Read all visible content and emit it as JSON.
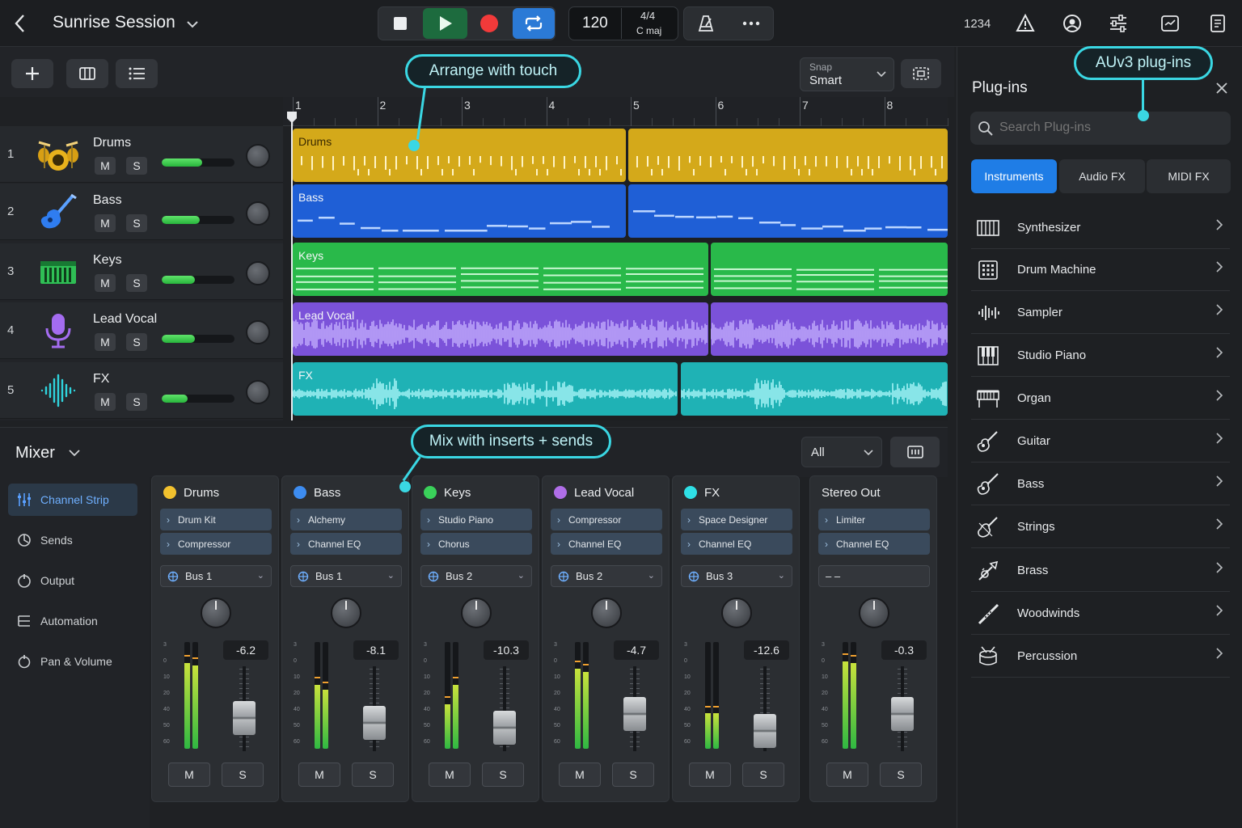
{
  "app": {
    "title": "Sunrise Session",
    "tempo": "120",
    "signature": "4/4",
    "key": "C maj",
    "counter": "1234"
  },
  "toolbar": {
    "snap_label": "Snap",
    "snap_value": "Smart"
  },
  "ruler": {
    "bars": [
      "1",
      "2",
      "3",
      "4",
      "5",
      "6",
      "7",
      "8"
    ]
  },
  "tracks": [
    {
      "num": "1",
      "name": "Drums",
      "mute": "M",
      "solo": "S",
      "volume": 0.55,
      "color": "#d4a91a",
      "icon": "drum-kit-icon"
    },
    {
      "num": "2",
      "name": "Bass",
      "mute": "M",
      "solo": "S",
      "volume": 0.52,
      "color": "#1f5fd6",
      "icon": "bass-guitar-icon"
    },
    {
      "num": "3",
      "name": "Keys",
      "mute": "M",
      "solo": "S",
      "volume": 0.45,
      "color": "#29b94a",
      "icon": "keyboard-icon"
    },
    {
      "num": "4",
      "name": "Lead Vocal",
      "mute": "M",
      "solo": "S",
      "volume": 0.45,
      "color": "#7b52d9",
      "icon": "microphone-icon"
    },
    {
      "num": "5",
      "name": "FX",
      "mute": "M",
      "solo": "S",
      "volume": 0.35,
      "color": "#1fb2b5",
      "icon": "waveform-icon"
    }
  ],
  "callouts": {
    "arrange": "Arrange with touch",
    "mix": "Mix with inserts + sends",
    "plugins": "AUv3 plug-ins"
  },
  "mixer": {
    "title": "Mixer",
    "filter": "All",
    "side": [
      "Channel Strip",
      "Sends",
      "Output",
      "Automation",
      "Pan & Volume"
    ],
    "strips": [
      {
        "name": "Drums",
        "color": "#f2c12e",
        "slots": [
          "Drum Kit",
          "Compressor"
        ],
        "bus": "Bus 1",
        "db": "-6.2",
        "fader": 0.55,
        "meters": [
          0.8,
          0.78
        ]
      },
      {
        "name": "Bass",
        "color": "#3d8cf0",
        "slots": [
          "Alchemy",
          "Channel EQ"
        ],
        "bus": "Bus 1",
        "db": "-8.1",
        "fader": 0.48,
        "meters": [
          0.6,
          0.55
        ]
      },
      {
        "name": "Keys",
        "color": "#3ad15a",
        "slots": [
          "Studio Piano",
          "Chorus"
        ],
        "bus": "Bus 2",
        "db": "-10.3",
        "fader": 0.42,
        "meters": [
          0.42,
          0.6
        ]
      },
      {
        "name": "Lead Vocal",
        "color": "#b06ee8",
        "slots": [
          "Compressor",
          "Channel EQ"
        ],
        "bus": "Bus 2",
        "db": "-4.7",
        "fader": 0.6,
        "meters": [
          0.75,
          0.72
        ]
      },
      {
        "name": "FX",
        "color": "#2fe0e6",
        "slots": [
          "Space Designer",
          "Channel EQ"
        ],
        "bus": "Bus 3",
        "db": "-12.6",
        "fader": 0.38,
        "meters": [
          0.33,
          0.33
        ]
      },
      {
        "name": "Stereo Out",
        "color": "",
        "slots": [
          "Limiter",
          "Channel EQ"
        ],
        "bus": "–  –",
        "db": "-0.3",
        "fader": 0.6,
        "meters": [
          0.82,
          0.8
        ]
      }
    ],
    "mute": "M",
    "solo": "S",
    "scale": [
      "3",
      "0",
      "10",
      "20",
      "40",
      "50",
      "60"
    ]
  },
  "plugins": {
    "title": "Plug-ins",
    "search_placeholder": "Search Plug-ins",
    "tabs": [
      "Instruments",
      "Audio FX",
      "MIDI FX"
    ],
    "items": [
      {
        "label": "Synthesizer",
        "icon": "synth-keys-icon"
      },
      {
        "label": "Drum Machine",
        "icon": "drum-pad-icon"
      },
      {
        "label": "Sampler",
        "icon": "sampler-wave-icon"
      },
      {
        "label": "Studio Piano",
        "icon": "piano-icon"
      },
      {
        "label": "Organ",
        "icon": "organ-icon"
      },
      {
        "label": "Guitar",
        "icon": "guitar-icon"
      },
      {
        "label": "Bass",
        "icon": "bass-icon"
      },
      {
        "label": "Strings",
        "icon": "violin-icon"
      },
      {
        "label": "Brass",
        "icon": "trumpet-icon"
      },
      {
        "label": "Woodwinds",
        "icon": "flute-icon"
      },
      {
        "label": "Percussion",
        "icon": "snare-drum-icon"
      }
    ]
  }
}
